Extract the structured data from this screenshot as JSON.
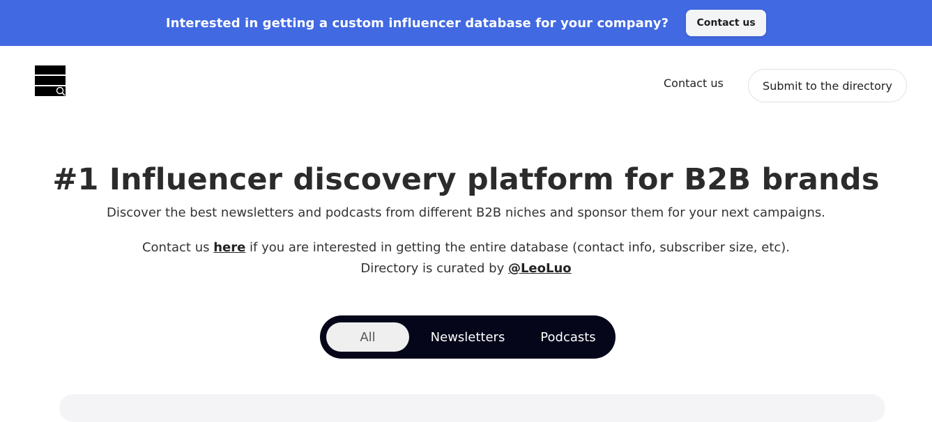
{
  "banner": {
    "text": "Interested in getting a custom influencer database for your company?",
    "button_label": "Contact us",
    "background_color": "#4169e1"
  },
  "logo": {
    "icon": "directory-search-logo-icon"
  },
  "nav": {
    "contact_label": "Contact us",
    "submit_label": "Submit to the directory"
  },
  "hero": {
    "title": "#1 Influencer discovery platform for B2B brands",
    "subtitle": "Discover the best newsletters and podcasts from different B2B niches and sponsor them for your next campaigns.",
    "line1_prefix": "Contact us ",
    "line1_link": "here",
    "line1_suffix": " if you are interested in getting the entire database (contact info, subscriber size, etc).",
    "line2_prefix": "Directory is curated by ",
    "line2_link": "@LeoLuo"
  },
  "filters": {
    "options": [
      "All",
      "Newsletters",
      "Podcasts"
    ],
    "selected": "All",
    "background_color": "#05061a"
  }
}
